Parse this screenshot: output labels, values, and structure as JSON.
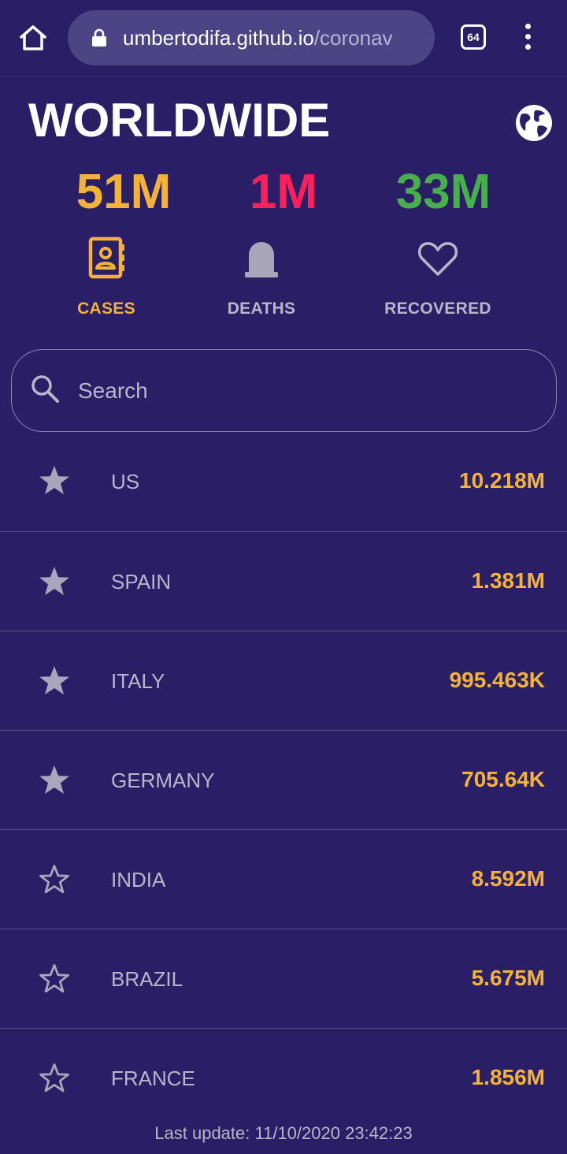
{
  "browser": {
    "url_host": "umbertodifa.github.io",
    "url_path": "/coronav",
    "tab_count": "64"
  },
  "header": {
    "title": "WORLDWIDE"
  },
  "stats": {
    "cases": "51M",
    "deaths": "1M",
    "recovered": "33M"
  },
  "tabs": [
    {
      "label": "CASES",
      "icon": "contact-book-icon",
      "active": true
    },
    {
      "label": "DEATHS",
      "icon": "tombstone-icon",
      "active": false
    },
    {
      "label": "RECOVERED",
      "icon": "heart-icon",
      "active": false
    }
  ],
  "search": {
    "placeholder": "Search"
  },
  "countries": [
    {
      "name": "US",
      "value": "10.218M",
      "favorite": true
    },
    {
      "name": "SPAIN",
      "value": "1.381M",
      "favorite": true
    },
    {
      "name": "ITALY",
      "value": "995.463K",
      "favorite": true
    },
    {
      "name": "GERMANY",
      "value": "705.64K",
      "favorite": true
    },
    {
      "name": "INDIA",
      "value": "8.592M",
      "favorite": false
    },
    {
      "name": "BRAZIL",
      "value": "5.675M",
      "favorite": false
    },
    {
      "name": "FRANCE",
      "value": "1.856M",
      "favorite": false
    }
  ],
  "footer": {
    "last_update": "Last update: 11/10/2020 23:42:23"
  },
  "colors": {
    "background": "#2a1f66",
    "cases": "#f5b335",
    "deaths": "#ff1f5a",
    "recovered": "#47b04a",
    "muted": "#b9b6c9"
  }
}
